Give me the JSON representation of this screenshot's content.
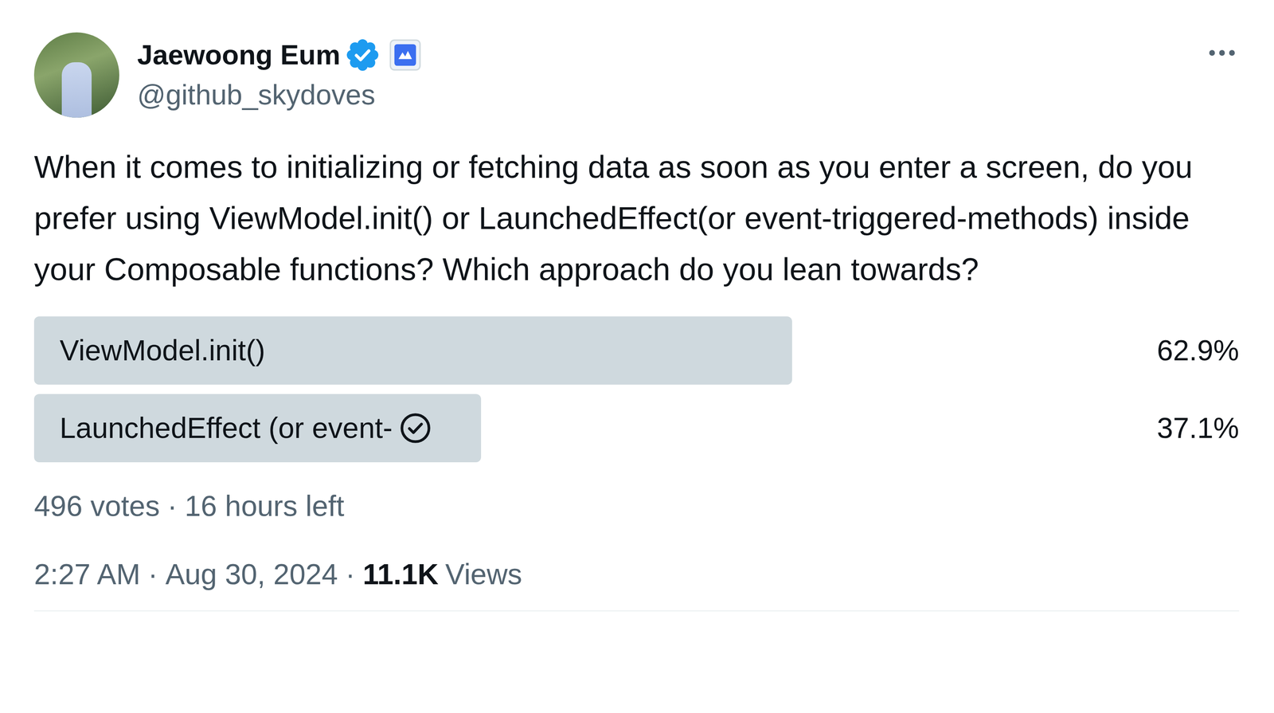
{
  "author": {
    "name": "Jaewoong Eum",
    "handle": "@github_skydoves",
    "verified": true,
    "affiliated": true
  },
  "text": "When it comes to initializing or fetching data as soon as you enter a screen, do you prefer using ViewModel.init() or LaunchedEffect(or event-triggered-methods) inside your Composable functions? Which approach do you lean towards?",
  "poll": {
    "options": [
      {
        "label": "ViewModel.init()",
        "percent": "62.9%",
        "level": 0.629,
        "selected": false
      },
      {
        "label": "LaunchedEffect (or event-",
        "percent": "37.1%",
        "level": 0.371,
        "selected": true
      }
    ],
    "votes": "496 votes",
    "separator": "·",
    "time_left": "16 hours left"
  },
  "meta": {
    "time": "2:27 AM",
    "date": "Aug 30, 2024",
    "separator": "·",
    "views_count": "11.1K",
    "views_label": "Views"
  }
}
